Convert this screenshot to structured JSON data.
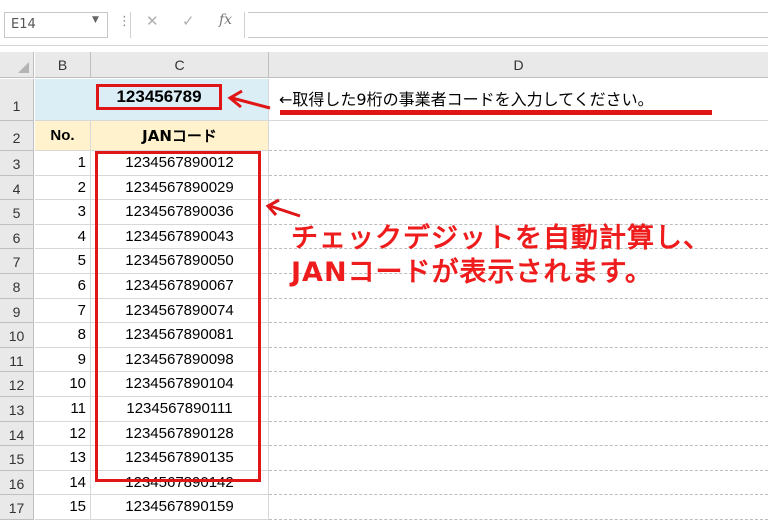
{
  "formula_bar": {
    "name_box": "E14",
    "dots": "⋮",
    "cancel_symbol": "✕",
    "enter_symbol": "✓",
    "fx_label": "fx",
    "formula": ""
  },
  "columns": [
    "B",
    "C",
    "D"
  ],
  "rows": [
    "1",
    "2",
    "3",
    "4",
    "5",
    "6",
    "7",
    "8",
    "9",
    "10",
    "11",
    "12",
    "13",
    "14",
    "15",
    "16",
    "17"
  ],
  "cells": {
    "company_code": "123456789",
    "instruction": "←取得した9桁の事業者コードを入力してください。",
    "header_no": "No.",
    "header_jan": "JANコード",
    "items": [
      {
        "no": "1",
        "jan": "1234567890012"
      },
      {
        "no": "2",
        "jan": "1234567890029"
      },
      {
        "no": "3",
        "jan": "1234567890036"
      },
      {
        "no": "4",
        "jan": "1234567890043"
      },
      {
        "no": "5",
        "jan": "1234567890050"
      },
      {
        "no": "6",
        "jan": "1234567890067"
      },
      {
        "no": "7",
        "jan": "1234567890074"
      },
      {
        "no": "8",
        "jan": "1234567890081"
      },
      {
        "no": "9",
        "jan": "1234567890098"
      },
      {
        "no": "10",
        "jan": "1234567890104"
      },
      {
        "no": "11",
        "jan": "1234567890111"
      },
      {
        "no": "12",
        "jan": "1234567890128"
      },
      {
        "no": "13",
        "jan": "1234567890135"
      },
      {
        "no": "14",
        "jan": "1234567890142"
      },
      {
        "no": "15",
        "jan": "1234567890159"
      }
    ]
  },
  "callout": {
    "line1": "チェックデジットを自動計算し、",
    "line2": "JANコードが表示されます。"
  },
  "colors": {
    "accent_red": "#e01515",
    "header_fill": "#fff2cc",
    "input_fill": "#dbeef6"
  }
}
